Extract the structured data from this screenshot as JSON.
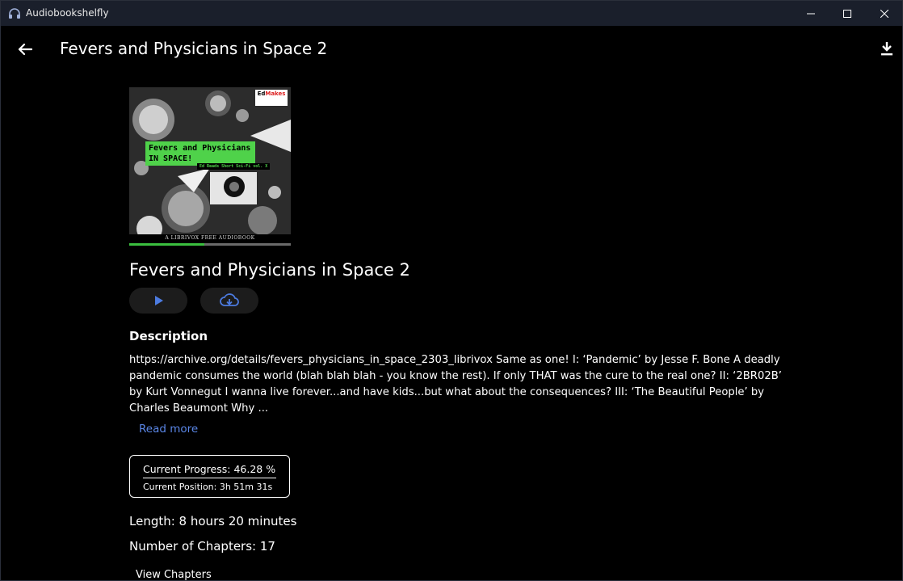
{
  "window": {
    "app_title": "Audiobookshelfly",
    "icons": {
      "app": "headphones-icon",
      "minimize": "minimize-icon",
      "maximize": "maximize-icon",
      "close": "close-icon"
    }
  },
  "header": {
    "title": "Fevers and Physicians in Space 2",
    "back_icon": "arrow-left-icon",
    "download_icon": "download-icon"
  },
  "cover": {
    "green_title": "Fevers and Physicians IN SPACE!",
    "subtitle": "Ed Reads Short Sci-Fi vol. X",
    "publisher_top": "Ed",
    "publisher_bold": "Makes",
    "footer": "A LIBRIVOX FREE AUDIOBOOK",
    "progress_fraction": 0.4628
  },
  "book": {
    "title": "Fevers and Physicians in Space 2",
    "play_icon": "play-icon",
    "download_cloud_icon": "cloud-download-icon"
  },
  "description": {
    "heading": "Description",
    "text": "https://archive.org/details/fevers_physicians_in_space_2303_librivox Same as one! I: ‘Pandemic’ by Jesse F. Bone A deadly pandemic consumes the world (blah blah blah - you know the rest). If only THAT was the cure to the real one? II: ‘2BR02B’ by Kurt Vonnegut I wanna live forever...and have kids...but what about the consequences? III: ‘The Beautiful People’ by Charles Beaumont Why ...",
    "read_more": "Read more"
  },
  "progress": {
    "current_progress": "Current Progress: 46.28 %",
    "current_position": "Current Position: 3h 51m 31s"
  },
  "details": {
    "length": "Length: 8 hours 20 minutes",
    "chapters": "Number of Chapters: 17",
    "view_chapters": "View Chapters"
  },
  "colors": {
    "titlebar": "#1a1f2b",
    "accent": "#5a86e6",
    "button_bg": "#1c1c1c",
    "cover_green": "#4fd24a"
  }
}
